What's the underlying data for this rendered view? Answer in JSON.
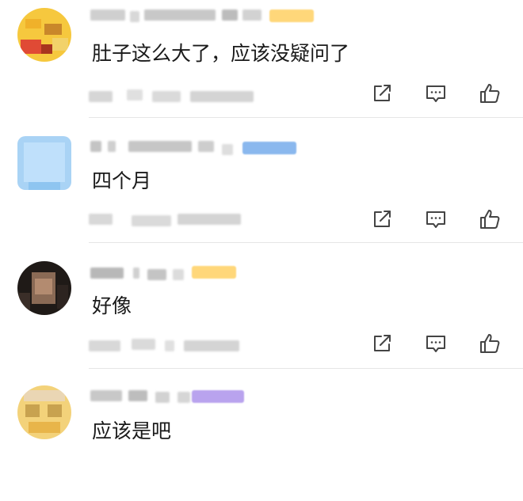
{
  "comments": [
    {
      "text": "肚子这么大了，应该没疑问了",
      "badge_color": "#ffd77a"
    },
    {
      "text": "四个月",
      "badge_color": "#8ab8ee"
    },
    {
      "text": "好像",
      "badge_color": "#ffd77a"
    },
    {
      "text": "应该是吧",
      "badge_color": "#b9a3ee"
    }
  ],
  "actions": {
    "share_icon": "share-icon",
    "reply_icon": "comment-icon",
    "like_icon": "thumbs-up-icon"
  }
}
